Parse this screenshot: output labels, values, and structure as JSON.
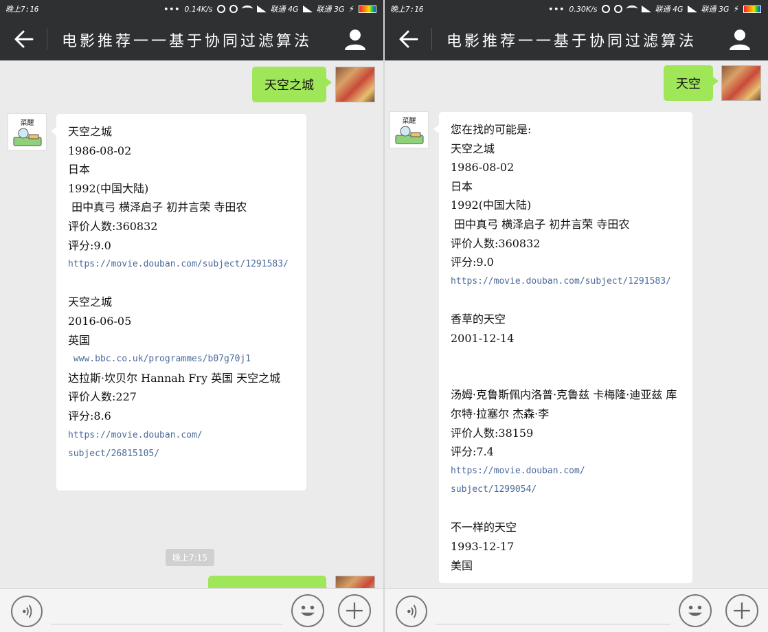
{
  "status_left": {
    "time": "晚上7:16",
    "dots": "•••",
    "speed": "0.14K/s",
    "carrier1": "联通 4G",
    "carrier2": "联通 3G"
  },
  "status_right": {
    "time": "晚上7:16",
    "dots": "•••",
    "speed": "0.30K/s",
    "carrier1": "联通 4G",
    "carrier2": "联通 3G"
  },
  "header": {
    "title": "电影推荐一一基于协同过滤算法"
  },
  "bot": {
    "name": "菜醒"
  },
  "left_chat": {
    "my_message": "天空之城",
    "reply": [
      "天空之城",
      "1986-08-02",
      "日本",
      "1992(中国大陆)",
      " 田中真弓 横泽启子 初井言荣 寺田农",
      "评价人数:360832",
      "评分:9.0",
      "https://movie.douban.com/subject/1291583/",
      "",
      "天空之城",
      "2016-06-05",
      "英国",
      " www.bbc.co.uk/programmes/b07g70j1",
      "达拉斯·坎贝尔 Hannah Fry 英国 天空之城",
      "评价人数:227",
      "评分:8.6",
      "https://movie.douban.com/",
      "subject/26815105/",
      ""
    ],
    "timestamp": "晚上7:15"
  },
  "right_chat": {
    "my_message": "天空",
    "reply": [
      "您在找的可能是:",
      "天空之城",
      "1986-08-02",
      "日本",
      "1992(中国大陆)",
      " 田中真弓 横泽启子 初井言荣 寺田农",
      "评价人数:360832",
      "评分:9.0",
      "https://movie.douban.com/subject/1291583/",
      "",
      "香草的天空",
      "2001-12-14",
      "",
      "",
      "汤姆·克鲁斯佩内洛普·克鲁兹 卡梅隆·迪亚兹 库尔特·拉塞尔 杰森·李",
      "评价人数:38159",
      "评分:7.4",
      "https://movie.douban.com/",
      "subject/1299054/",
      "",
      "不一样的天空",
      "1993-12-17",
      "美国"
    ]
  }
}
